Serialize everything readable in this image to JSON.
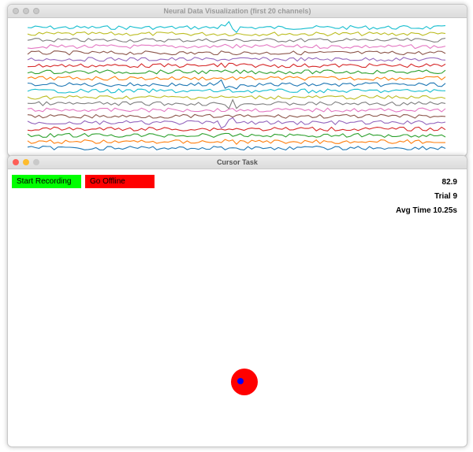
{
  "neural_window": {
    "title": "Neural Data Visualization (first 20 channels)",
    "channel_count": 20,
    "channel_colors": [
      "#1f77b4",
      "#ff7f0e",
      "#2ca02c",
      "#d62728",
      "#9467bd",
      "#8c564b",
      "#e377c2",
      "#7f7f7f",
      "#bcbd22",
      "#17becf",
      "#1f77b4",
      "#ff7f0e",
      "#2ca02c",
      "#d62728",
      "#9467bd",
      "#8c564b",
      "#e377c2",
      "#7f7f7f",
      "#bcbd22",
      "#17becf"
    ]
  },
  "cursor_window": {
    "title": "Cursor Task",
    "buttons": {
      "record_label": "Start Recording",
      "record_color": "#00ff00",
      "offline_label": "Go Offline",
      "offline_color": "#ff0000"
    },
    "stats": {
      "score": "82.9",
      "trial": "Trial 9",
      "avg_time": "Avg Time 10.25s"
    },
    "target_color": "#ff0000",
    "cursor_color": "#0000ff"
  }
}
